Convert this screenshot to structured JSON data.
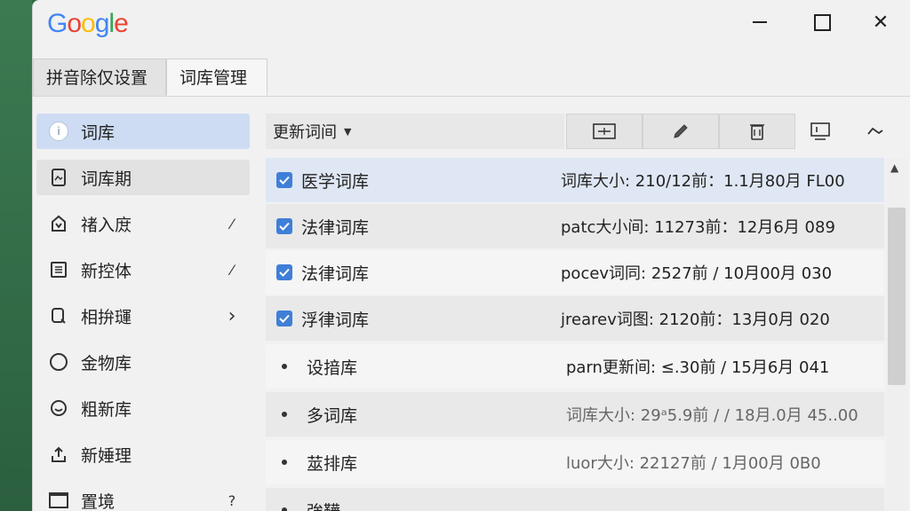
{
  "window": {
    "logo": [
      "G",
      "o",
      "o",
      "g",
      "l",
      "e"
    ],
    "logo_colors": [
      "#4285F4",
      "#EA4335",
      "#FBBC05",
      "#4285F4",
      "#34A853",
      "#EA4335"
    ],
    "controls": {
      "minimize": "minimize",
      "maximize": "maximize",
      "close": "✕"
    }
  },
  "tabs": [
    {
      "label": "拼音除仅设置"
    },
    {
      "label": "词库管理"
    }
  ],
  "sidebar": {
    "items": [
      {
        "label": "词库",
        "icon": "info-icon",
        "trail": ""
      },
      {
        "label": "词库期",
        "icon": "document-icon",
        "trail": ""
      },
      {
        "label": "禇入庻",
        "icon": "import-icon",
        "trail": "⁄"
      },
      {
        "label": "新控体",
        "icon": "list-icon",
        "trail": "⁄"
      },
      {
        "label": "相拚璭",
        "icon": "search-icon",
        "trail": "›"
      },
      {
        "label": "金物库",
        "icon": "circle-icon",
        "trail": ""
      },
      {
        "label": "粗新库",
        "icon": "smile-icon",
        "trail": ""
      },
      {
        "label": "新娷理",
        "icon": "upload-icon",
        "trail": ""
      },
      {
        "label": "置境",
        "icon": "tray-icon",
        "trail": "?"
      }
    ]
  },
  "toolbar": {
    "dropdown_label": "更新词间"
  },
  "list": {
    "rows": [
      {
        "name": "医学词库",
        "info": "词库大小:  210/12前：1.1月80月 FL00",
        "checked": true
      },
      {
        "name": "法律词库",
        "info": "patc大小间:  11273前：12月6月 089",
        "checked": true
      },
      {
        "name": "法律词库",
        "info": "pocev词同:  2527前 / 10月00月 030",
        "checked": true
      },
      {
        "name": "浮律词库",
        "info": "jrearev词图:  2120前：13月0月 020",
        "checked": true
      },
      {
        "name": "设揞库",
        "info": "parn更新间:  ≤.30前 / 15月6月 041",
        "checked": false
      },
      {
        "name": "多词库",
        "info": "词库大小:  29ᵃ5.9前 / / 18月.0月 45..00",
        "checked": false
      },
      {
        "name": "莁排库",
        "info": "luor大小:  22127前 / 1月00月 0B0",
        "checked": false
      },
      {
        "name": "強鞾",
        "info": "",
        "checked": false
      }
    ]
  }
}
